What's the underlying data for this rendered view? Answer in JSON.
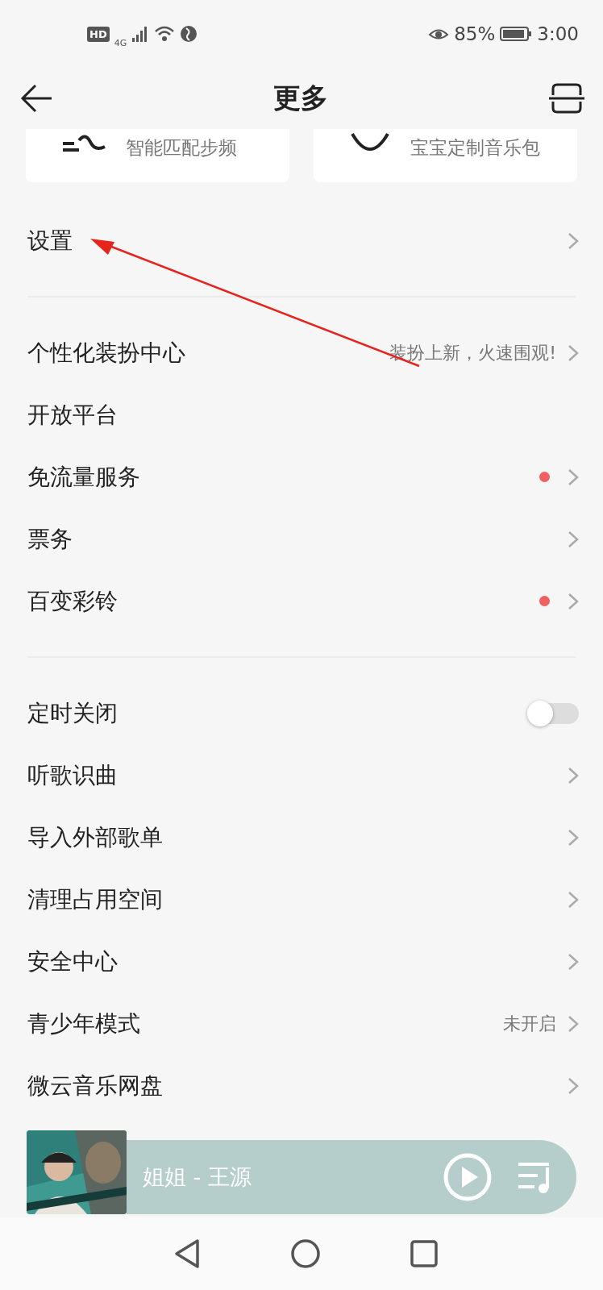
{
  "status_bar": {
    "left": [
      "HD",
      "4G"
    ],
    "battery_percent": "85%",
    "time": "3:00"
  },
  "header": {
    "title": "更多"
  },
  "cards": [
    {
      "label": "智能匹配步频"
    },
    {
      "label": "宝宝定制音乐包"
    }
  ],
  "groups": [
    {
      "items": [
        {
          "kind": "link",
          "label": "设置",
          "new_dot": false
        }
      ]
    },
    {
      "items": [
        {
          "kind": "link",
          "label": "个性化装扮中心",
          "hint": "装扮上新，火速围观!",
          "new_dot": false
        },
        {
          "kind": "plain",
          "label": "开放平台"
        },
        {
          "kind": "link",
          "label": "免流量服务",
          "new_dot": true
        },
        {
          "kind": "link",
          "label": "票务",
          "new_dot": false
        },
        {
          "kind": "link",
          "label": "百变彩铃",
          "new_dot": true
        }
      ]
    },
    {
      "items": [
        {
          "kind": "toggle",
          "label": "定时关闭",
          "on": false
        },
        {
          "kind": "link",
          "label": "听歌识曲",
          "new_dot": false
        },
        {
          "kind": "link",
          "label": "导入外部歌单",
          "new_dot": false
        },
        {
          "kind": "link",
          "label": "清理占用空间",
          "new_dot": false
        },
        {
          "kind": "link",
          "label": "安全中心",
          "new_dot": false
        },
        {
          "kind": "link",
          "label": "青少年模式",
          "hint": "未开启",
          "new_dot": false
        },
        {
          "kind": "link",
          "label": "微云音乐网盘",
          "new_dot": false
        }
      ]
    }
  ],
  "player": {
    "song": "姐姐 - 王源",
    "playing": false
  }
}
